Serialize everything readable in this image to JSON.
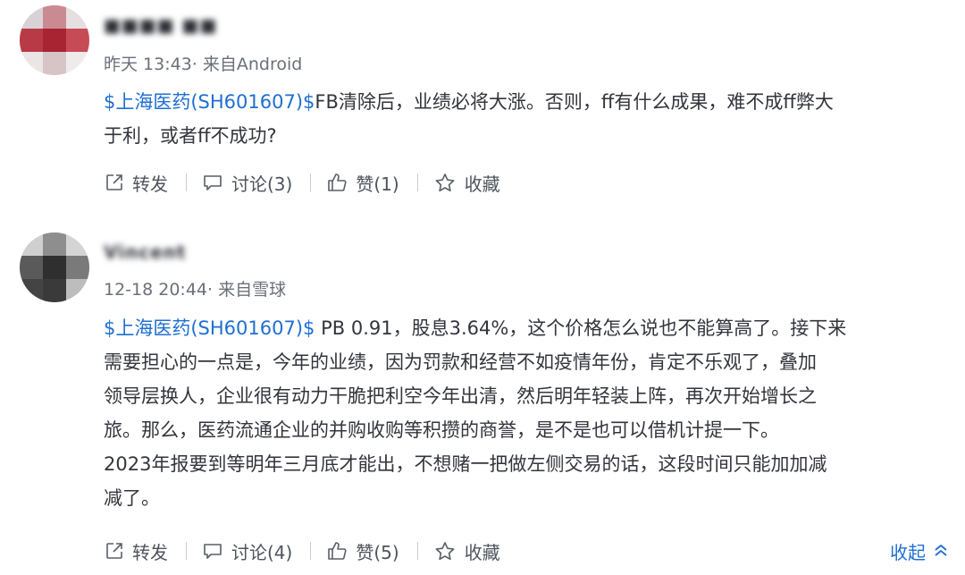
{
  "posts": [
    {
      "author": "■■■■ ■■ ■ 4X",
      "meta": "昨天 13:43· 来自Android",
      "stock_link": "$上海医药(SH601607)$",
      "lines": [
        "FB清除后，业绩必将大涨。否则，ff有什么成果，难不成ff弊大",
        "于利，或者ff不成功?"
      ],
      "actions": {
        "forward": "转发",
        "discuss": "讨论(3)",
        "like": "赞(1)",
        "favorite": "收藏"
      }
    },
    {
      "author": "Vincent ■■■■■ing",
      "meta": "12-18 20:44· 来自雪球",
      "stock_link": "$上海医药(SH601607)$",
      "lines": [
        " PB 0.91，股息3.64%，这个价格怎么说也不能算高了。接下来",
        "需要担心的一点是，今年的业绩，因为罚款和经营不如疫情年份，肯定不乐观了，叠加",
        "领导层换人，企业很有动力干脆把利空今年出清，然后明年轻装上阵，再次开始增长之",
        "旅。那么，医药流通企业的并购收购等积攒的商誉，是不是也可以借机计提一下。",
        "2023年报要到等明年三月底才能出，不想赌一把做左侧交易的话，这段时间只能加加减",
        "减了。"
      ],
      "actions": {
        "forward": "转发",
        "discuss": "讨论(4)",
        "like": "赞(5)",
        "favorite": "收藏"
      },
      "collapse": "收起"
    }
  ],
  "colors": {
    "link": "#1f6fd1",
    "text": "#33353c",
    "meta": "#6b6f78",
    "separator": "#c9ccd2"
  },
  "icons": [
    "forward-icon",
    "comment-icon",
    "thumbs-up-icon",
    "star-icon",
    "chevron-up-icon"
  ]
}
